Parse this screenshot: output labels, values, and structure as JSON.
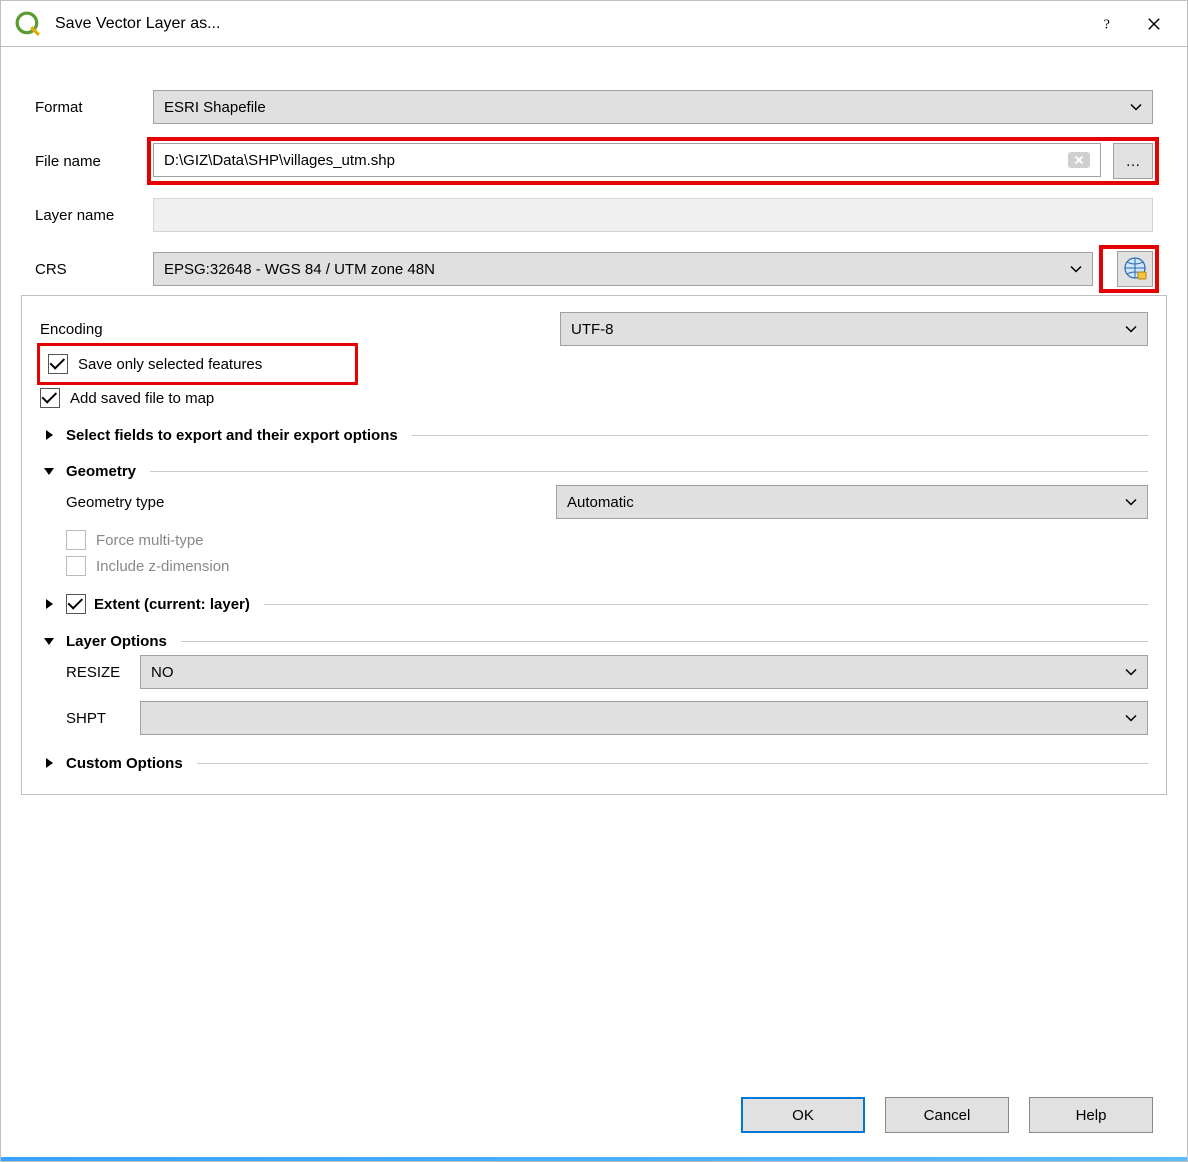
{
  "window": {
    "title": "Save Vector Layer as..."
  },
  "labels": {
    "format": "Format",
    "file_name": "File name",
    "layer_name": "Layer name",
    "crs": "CRS",
    "encoding": "Encoding",
    "save_only_selected": "Save only selected features",
    "add_saved_to_map": "Add saved file to map",
    "select_fields": "Select fields to export and their export options",
    "geometry": "Geometry",
    "geometry_type": "Geometry type",
    "force_multi": "Force multi-type",
    "include_z": "Include z-dimension",
    "extent": "Extent (current: layer)",
    "layer_options": "Layer Options",
    "resize": "RESIZE",
    "shpt": "SHPT",
    "custom_options": "Custom Options"
  },
  "values": {
    "format": "ESRI Shapefile",
    "file_name": "D:\\GIZ\\Data\\SHP\\villages_utm.shp",
    "layer_name": "",
    "crs": "EPSG:32648 - WGS 84 / UTM zone 48N",
    "encoding": "UTF-8",
    "geometry_type": "Automatic",
    "resize": "NO",
    "shpt": ""
  },
  "checks": {
    "save_only_selected": true,
    "add_saved_to_map": true,
    "extent": true
  },
  "buttons": {
    "browse": "…",
    "ok": "OK",
    "cancel": "Cancel",
    "help": "Help"
  }
}
